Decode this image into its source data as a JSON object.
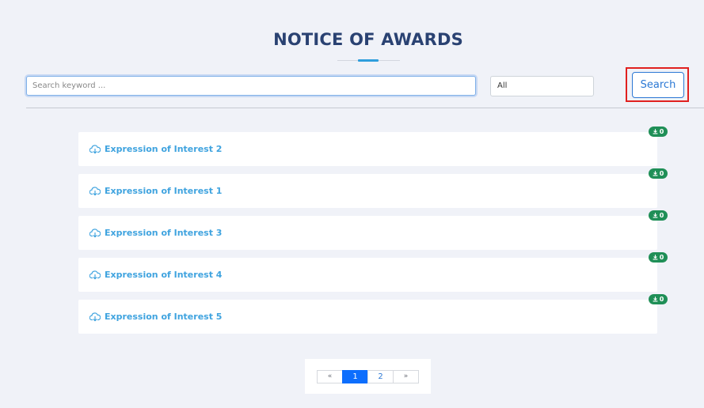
{
  "page_title": "NOTICE OF AWARDS",
  "search": {
    "placeholder": "Search keyword ...",
    "value": ""
  },
  "filter": {
    "selected": "All"
  },
  "search_button_label": "Search",
  "notices": [
    {
      "title": "Expression of Interest 2",
      "downloads": "0"
    },
    {
      "title": "Expression of Interest 1",
      "downloads": "0"
    },
    {
      "title": "Expression of Interest 3",
      "downloads": "0"
    },
    {
      "title": "Expression of Interest 4",
      "downloads": "0"
    },
    {
      "title": "Expression of Interest 5",
      "downloads": "0"
    }
  ],
  "pagination": {
    "prev_label": "«",
    "pages": [
      "1",
      "2"
    ],
    "current": "1",
    "next_label": "»"
  },
  "colors": {
    "title": "#2a4272",
    "accent": "#2f9edc",
    "link": "#3fa3df",
    "badge": "#1f8f57",
    "primary": "#0d6efd",
    "highlight": "#e0201f"
  },
  "icons": {
    "notice_icon": "cloud-download-icon",
    "badge_icon": "download-icon"
  }
}
